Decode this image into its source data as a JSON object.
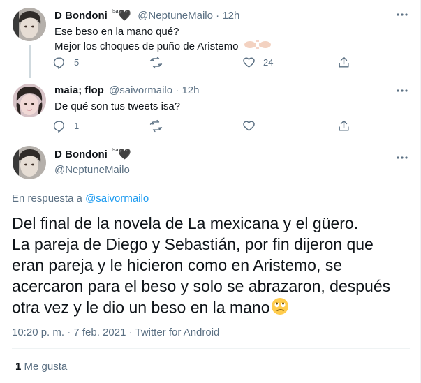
{
  "tweet1": {
    "author_name": "D Bondoni",
    "author_sup": "Isa",
    "author_heart": "🖤",
    "handle": "@NeptuneMailo",
    "dot": "·",
    "time": "12h",
    "line1": "Ese beso en la mano qué?",
    "line2": "Mejor los choques de puño de Aristemo",
    "reply_count": "5",
    "retweet_count": "",
    "like_count": "24"
  },
  "tweet2": {
    "author_name": "maia; flop",
    "handle": "@saivormailo",
    "dot": "·",
    "time": "12h",
    "text": "De qué son tus tweets isa?",
    "reply_count": "1",
    "retweet_count": "",
    "like_count": ""
  },
  "main": {
    "author_name": "D Bondoni",
    "author_sup": "Isa",
    "author_heart": "🖤",
    "handle": "@NeptuneMailo",
    "reply_prefix": "En respuesta a",
    "reply_handle": "@saivormailo",
    "text": "Del final de la novela de La mexicana y el güero.\nLa pareja de Diego y Sebastián, por fin dijeron que eran pareja y le hicieron como en Aristemo, se acercaron para el beso y solo se abrazaron, después otra vez y le dio un beso en la mano",
    "timestamp": "10:20 p. m. · 7 feb. 2021 · Twitter for Android",
    "like_count": "1",
    "like_label": "Me gusta"
  },
  "icons": [
    "more-icon",
    "reply-icon",
    "retweet-icon",
    "like-icon",
    "share-icon",
    "fist-bump-emoji",
    "eye-roll-emoji"
  ],
  "colors": {
    "link": "#1d9bf0",
    "muted": "#5b7083",
    "text": "#0f1419",
    "divider": "#eff3f4"
  }
}
